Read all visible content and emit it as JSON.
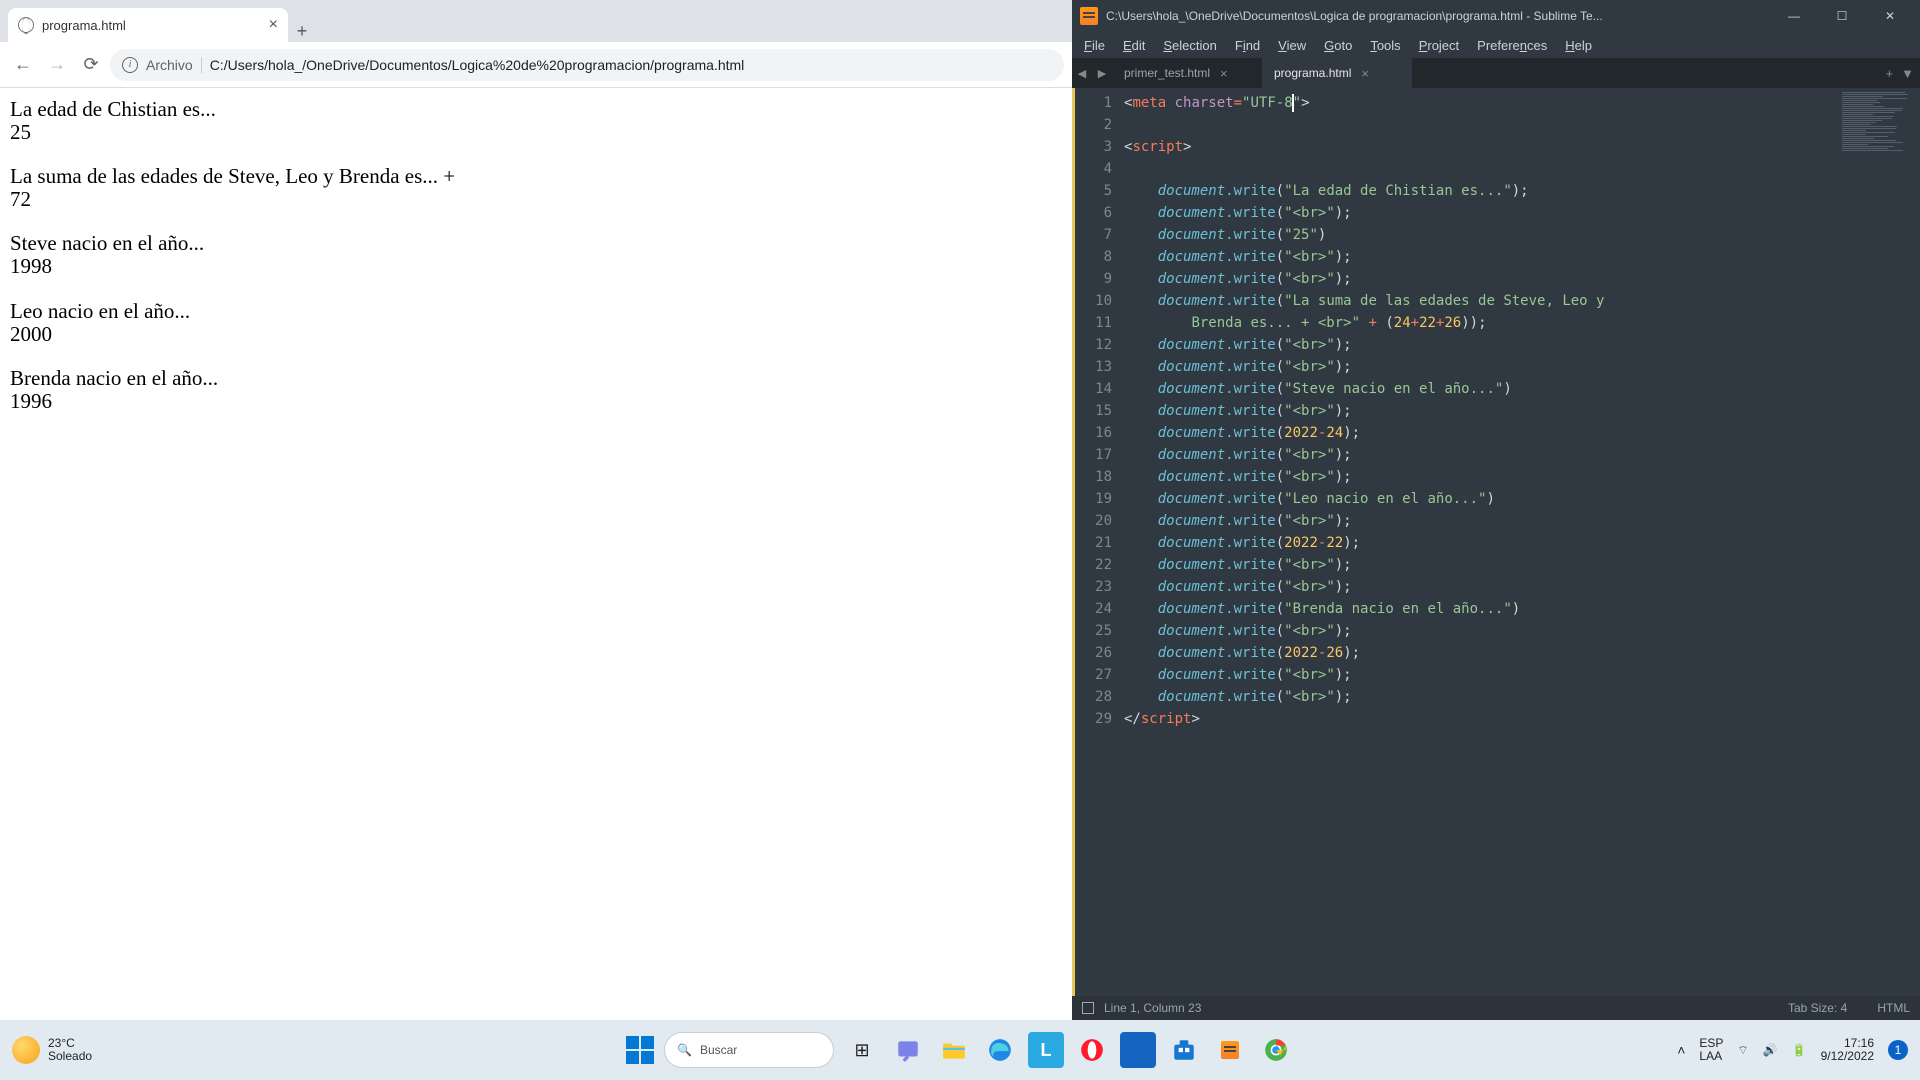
{
  "browser": {
    "tab_title": "programa.html",
    "address_prefix": "Archivo",
    "url": "C:/Users/hola_/OneDrive/Documentos/Logica%20de%20programacion/programa.html",
    "content": {
      "l1": "La edad de Chistian es...",
      "v1": "25",
      "l2": "La suma de las edades de Steve, Leo y Brenda es... +",
      "v2": "72",
      "l3": "Steve nacio en el año...",
      "v3": "1998",
      "l4": "Leo nacio en el año...",
      "v4": "2000",
      "l5": "Brenda nacio en el año...",
      "v5": "1996"
    }
  },
  "sublime": {
    "title": "C:\\Users\\hola_\\OneDrive\\Documentos\\Logica de programacion\\programa.html - Sublime Te...",
    "menus": [
      "File",
      "Edit",
      "Selection",
      "Find",
      "View",
      "Goto",
      "Tools",
      "Project",
      "Preferences",
      "Help"
    ],
    "tabs": [
      {
        "name": "primer_test.html",
        "active": false
      },
      {
        "name": "programa.html",
        "active": true
      }
    ],
    "status_left": "Line 1, Column 23",
    "status_tab": "Tab Size: 4",
    "status_lang": "HTML",
    "line_count": 29,
    "code": {
      "l1_tag": "meta",
      "l1_attr": "charset",
      "l1_val": "\"UTF-8\"",
      "l3_tag": "script",
      "doc": "document",
      "write": ".write",
      "s5": "\"La edad de Chistian es...\"",
      "s6": "\"<br>\"",
      "s7": "\"25\"",
      "s10a": "\"La suma de las edades de Steve, Leo y ",
      "s10b": "Brenda es... + <br>\"",
      "expr10": "24",
      "expr10b": "22",
      "expr10c": "26",
      "s13": "\"Steve nacio en el año...\"",
      "y15a": "2022",
      "y15b": "24",
      "s19": "\"Leo nacio en el año...\"",
      "y20a": "2022",
      "y20b": "22",
      "s23": "\"Brenda nacio en el año...\"",
      "y25a": "2022",
      "y25b": "26",
      "l28_tag": "script"
    }
  },
  "taskbar": {
    "temp": "23°C",
    "weather": "Soleado",
    "search": "Buscar",
    "kb1": "ESP",
    "kb2": "LAA",
    "time": "17:16",
    "date": "9/12/2022",
    "notif": "1"
  }
}
